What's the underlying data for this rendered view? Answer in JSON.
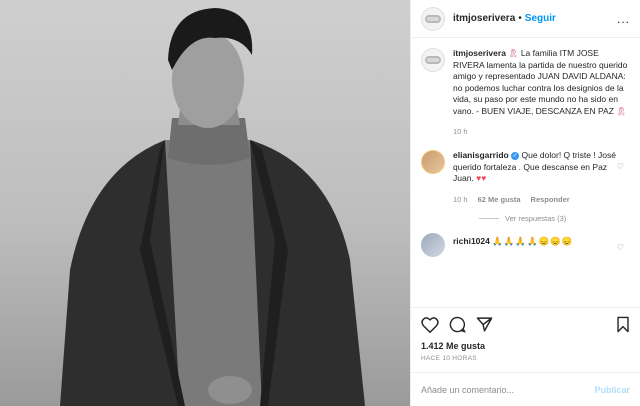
{
  "header": {
    "username": "itmjoserivera",
    "separator": "•",
    "follow_label": "Seguir",
    "more_label": "..."
  },
  "caption": {
    "username": "itmjoserivera",
    "text": "La familia ITM JOSE RIVERA lamenta la partida de nuestro querido amigo y representado JUAN DAVID ALDANA: no podemos luchar contra los designios de la vida, su paso por este mundo no ha sido en vano. - BUEN VIAJE, DESCANZA EN PAZ",
    "time": "10 h"
  },
  "comments": [
    {
      "username": "elianisgarrido",
      "verified": true,
      "text": "Que dolor! Q triste ! José querido fortaleza . Que descanse en Paz Juan.",
      "hearts": "♥♥",
      "time": "10 h",
      "likes": "62 Me gusta",
      "reply_label": "Responder",
      "view_replies": "Ver respuestas (3)"
    },
    {
      "username": "richi1024",
      "text": "🙏🙏🙏🙏😞😞😞"
    }
  ],
  "actions": {
    "likes_text": "1.412 Me gusta",
    "timestamp": "HACE 10 HORAS"
  },
  "add_comment": {
    "placeholder": "Añade un comentario...",
    "publish_label": "Publicar"
  },
  "colors": {
    "accent": "#0095f6",
    "publish_disabled": "#b2dffc",
    "heart": "#ed4956",
    "ribbon": "#c43c5e",
    "muted": "#8e8e8e"
  },
  "icons": [
    "heart-icon",
    "comment-icon",
    "share-icon",
    "bookmark-icon",
    "more-icon",
    "ribbon-icon",
    "verified-icon"
  ]
}
